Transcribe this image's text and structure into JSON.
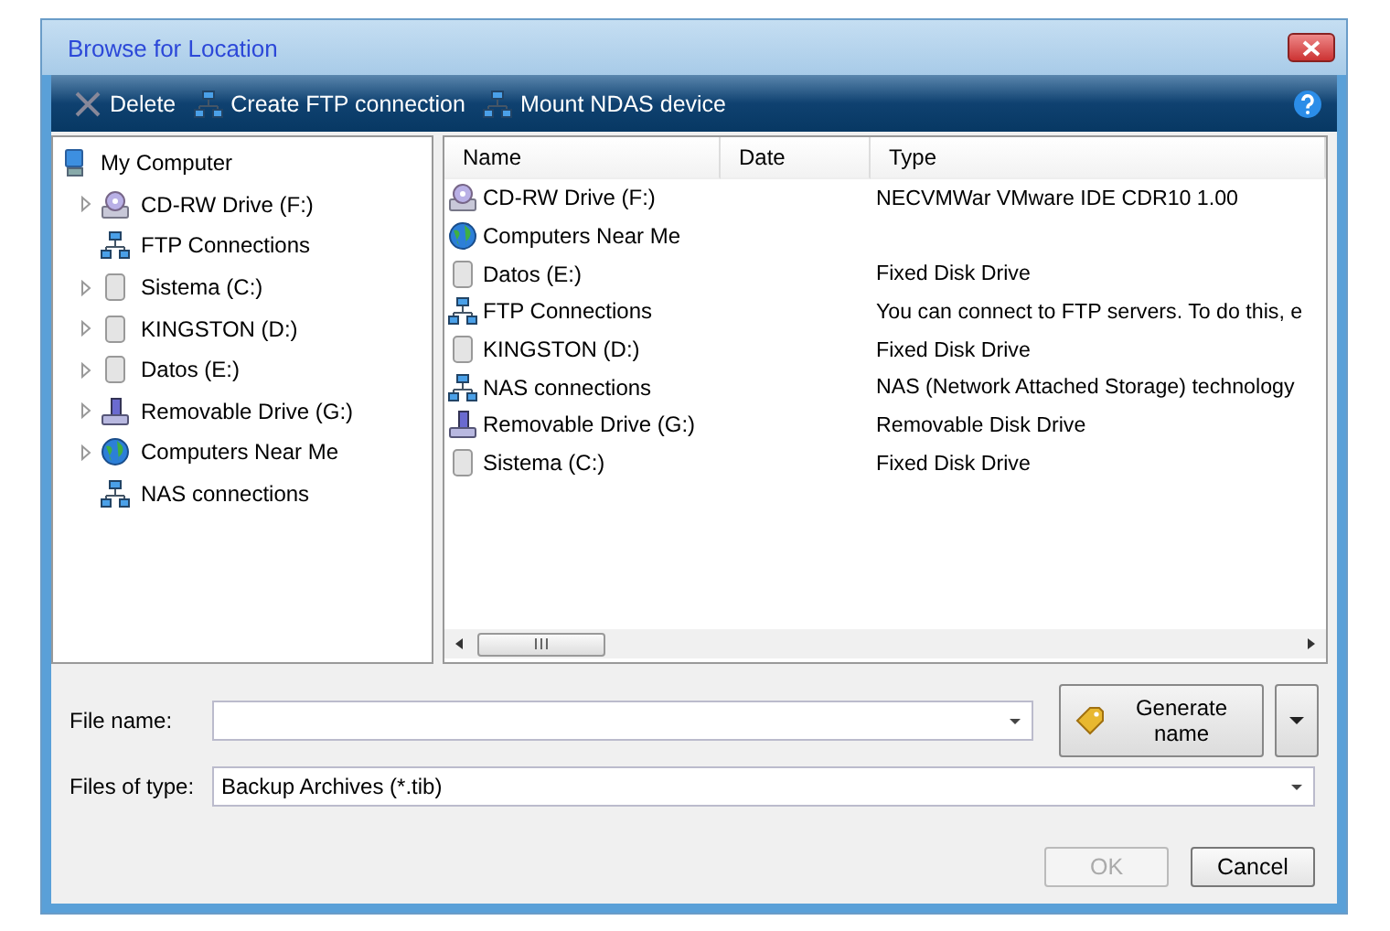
{
  "window": {
    "title": "Browse for Location"
  },
  "toolbar": {
    "items": [
      {
        "label": "Delete",
        "kind": "delete"
      },
      {
        "label": "Create FTP connection",
        "kind": "network"
      },
      {
        "label": "Mount NDAS device",
        "kind": "network"
      }
    ]
  },
  "tree": {
    "items": [
      {
        "label": "My Computer",
        "kind": "computer",
        "children": [
          {
            "label": "CD-RW Drive (F:)",
            "kind": "cd",
            "expandable": true
          },
          {
            "label": "FTP Connections",
            "kind": "network",
            "expandable": false
          },
          {
            "label": "Sistema (C:)",
            "kind": "disk",
            "expandable": true
          },
          {
            "label": "KINGSTON (D:)",
            "kind": "disk",
            "expandable": true
          },
          {
            "label": "Datos (E:)",
            "kind": "disk",
            "expandable": true
          },
          {
            "label": "Removable Drive (G:)",
            "kind": "usb",
            "expandable": true
          },
          {
            "label": "Computers Near Me",
            "kind": "globe",
            "expandable": true
          },
          {
            "label": "NAS connections",
            "kind": "network",
            "expandable": false
          }
        ]
      }
    ]
  },
  "table": {
    "columns": [
      "Name",
      "Date",
      "Type"
    ],
    "rows": [
      {
        "name": "CD-RW Drive (F:)",
        "kind": "cd",
        "type": "NECVMWar VMware IDE CDR10 1.00"
      },
      {
        "name": "Computers Near Me",
        "kind": "globe"
      },
      {
        "name": "Datos (E:)",
        "kind": "disk",
        "type": "Fixed Disk Drive"
      },
      {
        "name": "FTP Connections",
        "kind": "network",
        "type": "You can connect to FTP servers. To do this, e"
      },
      {
        "name": "KINGSTON (D:)",
        "kind": "disk",
        "type": "Fixed Disk Drive"
      },
      {
        "name": "NAS connections",
        "kind": "network",
        "type": "NAS (Network Attached Storage) technology"
      },
      {
        "name": "Removable Drive (G:)",
        "kind": "usb",
        "type": "Removable Disk Drive"
      },
      {
        "name": "Sistema (C:)",
        "kind": "disk",
        "type": "Fixed Disk Drive"
      }
    ]
  },
  "file_name": {
    "label": "File name:"
  },
  "generate_button": {
    "label": "Generate name"
  },
  "file_type": {
    "label": "Files of type:",
    "value": "Backup Archives (*.tib)"
  },
  "buttons": [
    {
      "label": "OK",
      "disabled": true
    },
    {
      "label": "Cancel",
      "disabled": false
    }
  ]
}
